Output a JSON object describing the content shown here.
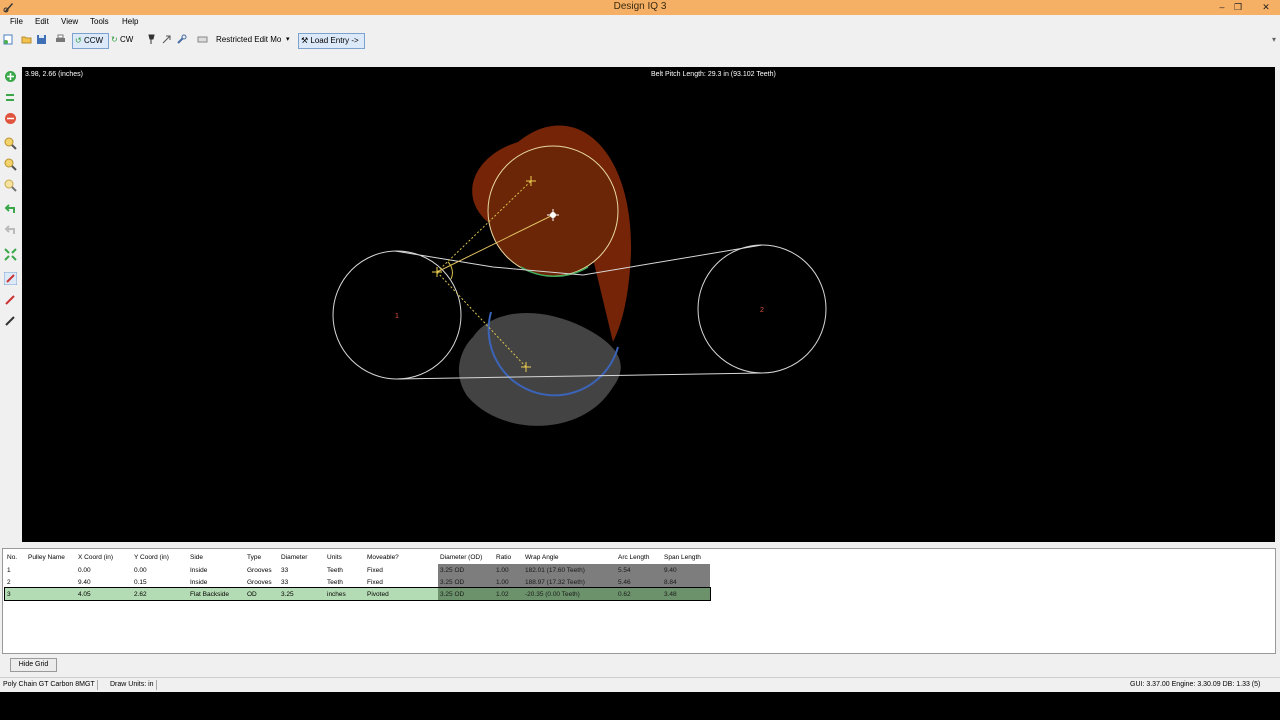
{
  "window": {
    "title": "Design IQ 3"
  },
  "menu": [
    "File",
    "Edit",
    "View",
    "Tools",
    "Help"
  ],
  "toolbar": {
    "ccw_label": "CCW",
    "cw_label": "CW",
    "mode_label": "Restricted Edit Mo",
    "load_entry_label": "Load Entry ->"
  },
  "canvas": {
    "coords": "3.98, 2.66 (inches)",
    "belt_info": "Belt Pitch Length: 29.3 in (93.102 Teeth)",
    "pulley_labels": [
      "1",
      "2"
    ]
  },
  "table": {
    "headers": [
      "No.",
      "Pulley Name",
      "X Coord (in)",
      "Y Coord (in)",
      "Side",
      "Type",
      "Diameter",
      "Units",
      "Moveable?",
      "Diameter (OD)",
      "Ratio",
      "Wrap Angle",
      "Arc Length",
      "Span Length"
    ],
    "rows": [
      [
        "1",
        "",
        "0.00",
        "0.00",
        "Inside",
        "Grooves",
        "33",
        "Teeth",
        "Fixed",
        "3.25 OD",
        "1.00",
        "182.01 (17.60 Teeth)",
        "5.54",
        "9.40"
      ],
      [
        "2",
        "",
        "9.40",
        "0.15",
        "Inside",
        "Grooves",
        "33",
        "Teeth",
        "Fixed",
        "3.25 OD",
        "1.00",
        "188.97 (17.32 Teeth)",
        "5.46",
        "8.84"
      ],
      [
        "3",
        "",
        "4.05",
        "2.62",
        "Flat Backside",
        "OD",
        "3.25",
        "inches",
        "Pivoted",
        "3.25 OD",
        "1.02",
        "-20.35 (0.00 Teeth)",
        "0.62",
        "3.48"
      ]
    ]
  },
  "hide_grid_label": "Hide Grid",
  "status": {
    "belt": "Poly Chain GT Carbon 8MGT",
    "units": "Draw Units: in",
    "version": "GUI: 3.37.00 Engine: 3.30.09 DB: 1.33 (5)"
  }
}
